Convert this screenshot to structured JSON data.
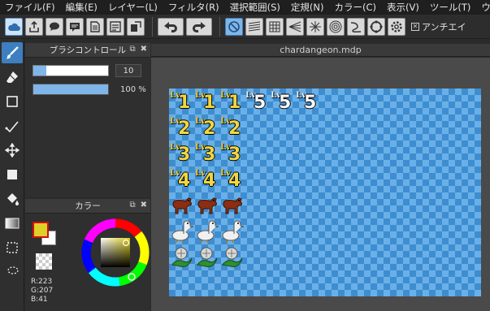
{
  "menubar": {
    "items": [
      "ファイル(F)",
      "編集(E)",
      "レイヤー(L)",
      "フィルタ(R)",
      "選択範囲(S)",
      "定規(N)",
      "カラー(C)",
      "表示(V)",
      "ツール(T)",
      "ウィ"
    ]
  },
  "toolbar": {
    "buttons": [
      "cloud-icon",
      "share-icon",
      "chat-icon",
      "comment-icon",
      "page-icon",
      "page-settings-icon",
      "material-icon",
      "undo-icon",
      "redo-icon",
      "snap-off-icon",
      "parallel-line-snap-icon",
      "grid-snap-icon",
      "perspective-snap-icon",
      "radial-snap-icon",
      "concentric-snap-icon",
      "curve-snap-icon",
      "circle-snap-icon",
      "settings-icon"
    ],
    "antialias_label": "アンチエイ",
    "antialias_checked": "✕"
  },
  "brush_panel": {
    "title": "ブラシコントロール",
    "size_value": "10",
    "size_fill_pct": 17,
    "opacity_value": "100 %",
    "opacity_fill_pct": 100
  },
  "color_panel": {
    "title": "カラー",
    "r_label": "R:223",
    "g_label": "G:207",
    "b_label": "B:41",
    "fg_color": "#dfcf29",
    "bg_color": "#ffffff"
  },
  "document": {
    "title": "chardangeon.mdp"
  },
  "sprites": {
    "lv_text": "Lv",
    "rows": [
      {
        "level": "1",
        "count": 3,
        "extra_white": 3,
        "extra_level": "5"
      },
      {
        "level": "2",
        "count": 3
      },
      {
        "level": "3",
        "count": 3
      },
      {
        "level": "4",
        "count": 3
      },
      {
        "kind": "donkey",
        "count": 3
      },
      {
        "kind": "duck",
        "count": 3
      },
      {
        "kind": "flower",
        "count": 3
      }
    ]
  },
  "accent_colors": {
    "menubar_bg": "#1f1f1f",
    "selected_tool": "#3d7fc0",
    "canvas_light": "#6ab0e8",
    "canvas_dark": "#3e8dd0"
  }
}
